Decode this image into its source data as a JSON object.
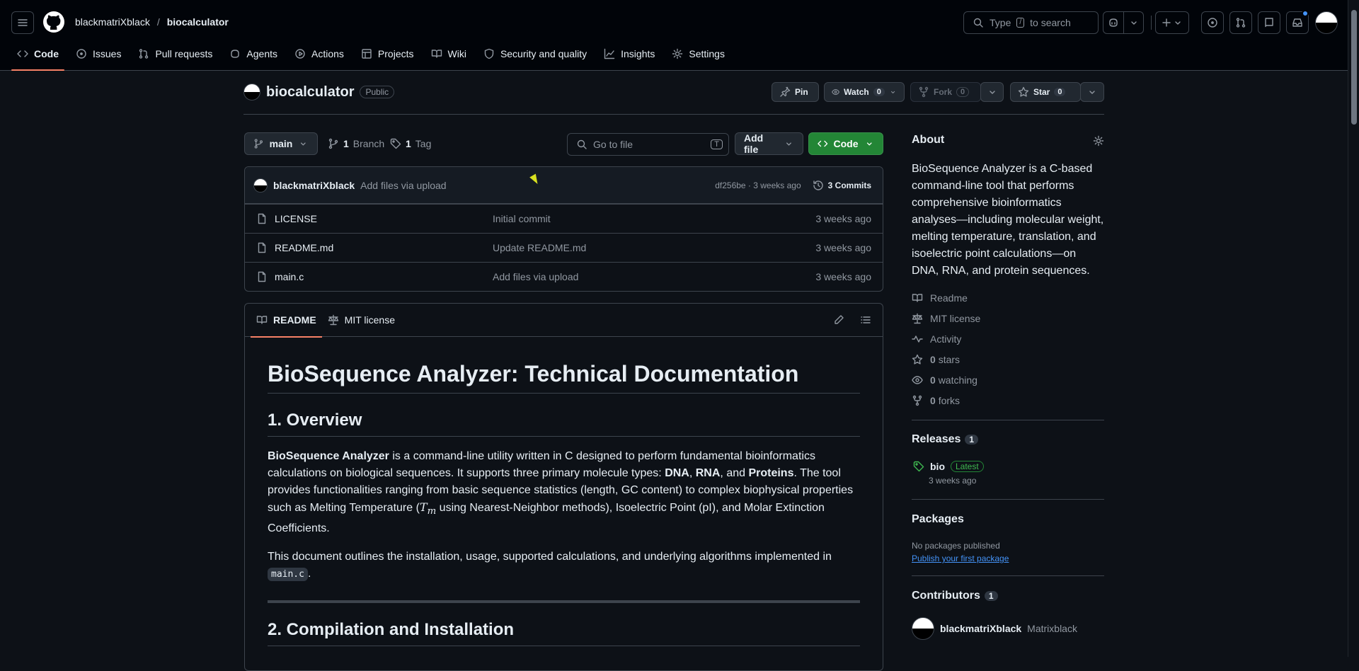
{
  "header": {
    "owner": "blackmatriXblack",
    "separator": "/",
    "repo": "biocalculator",
    "search_pre": "Type",
    "search_key": "/",
    "search_post": "to search"
  },
  "tabs": [
    {
      "label": "Code"
    },
    {
      "label": "Issues"
    },
    {
      "label": "Pull requests"
    },
    {
      "label": "Agents"
    },
    {
      "label": "Actions"
    },
    {
      "label": "Projects"
    },
    {
      "label": "Wiki"
    },
    {
      "label": "Security and quality"
    },
    {
      "label": "Insights"
    },
    {
      "label": "Settings"
    }
  ],
  "repo": {
    "name": "biocalculator",
    "visibility": "Public",
    "pin_label": "Pin",
    "watch_label": "Watch",
    "watch_count": "0",
    "fork_label": "Fork",
    "fork_count": "0",
    "star_label": "Star",
    "star_count": "0"
  },
  "branch_bar": {
    "branch": "main",
    "branch_count": "1",
    "branch_label": "Branch",
    "tag_count": "1",
    "tag_label": "Tag",
    "goto_placeholder": "Go to file",
    "goto_key": "T",
    "add_file": "Add file",
    "code": "Code"
  },
  "latest_commit": {
    "author": "blackmatriXblack",
    "message": "Add files via upload",
    "hash_age": "df256be · 3 weeks ago",
    "commits": "3 Commits"
  },
  "files": [
    {
      "name": "LICENSE",
      "commit": "Initial commit",
      "age": "3 weeks ago"
    },
    {
      "name": "README.md",
      "commit": "Update README.md",
      "age": "3 weeks ago"
    },
    {
      "name": "main.c",
      "commit": "Add files via upload",
      "age": "3 weeks ago"
    }
  ],
  "readme": {
    "tab_readme": "README",
    "tab_license": "MIT license",
    "h1": "BioSequence Analyzer: Technical Documentation",
    "h2_overview": "1. Overview",
    "p1_bold1": "BioSequence Analyzer",
    "p1_t1": " is a command-line utility written in C designed to perform fundamental bioinformatics calculations on biological sequences. It supports three primary molecule types: ",
    "p1_dna": "DNA",
    "p1_t2": ", ",
    "p1_rna": "RNA",
    "p1_t3": ", and ",
    "p1_prot": "Proteins",
    "p1_t4": ". The tool provides functionalities ranging from basic sequence statistics (length, GC content) to complex biophysical properties such as Melting Temperature (",
    "p1_tm": "T",
    "p1_tm_sub": "m",
    "p1_t5": " using Nearest-Neighbor methods), Isoelectric Point (pI), and Molar Extinction Coefficients.",
    "p2_t1": "This document outlines the installation, usage, supported calculations, and underlying algorithms implemented in ",
    "p2_code": "main.c",
    "p2_t2": ".",
    "h2_install": "2. Compilation and Installation"
  },
  "about": {
    "title": "About",
    "description": "BioSequence Analyzer is a C-based command-line tool that performs comprehensive bioinformatics analyses—including molecular weight, melting temperature, translation, and isoelectric point calculations—on DNA, RNA, and protein sequences.",
    "readme": "Readme",
    "license": "MIT license",
    "activity": "Activity",
    "stars_count": "0",
    "stars_label": "stars",
    "watching_count": "0",
    "watching_label": "watching",
    "forks_count": "0",
    "forks_label": "forks"
  },
  "releases": {
    "title": "Releases",
    "count": "1",
    "name": "bio",
    "badge": "Latest",
    "age": "3 weeks ago"
  },
  "packages": {
    "title": "Packages",
    "none": "No packages published",
    "publish": "Publish your first package"
  },
  "contributors": {
    "title": "Contributors",
    "count": "1",
    "login": "blackmatriXblack",
    "name": "Matrixblack"
  },
  "colors": {
    "background": "#0d1117",
    "header": "#010409",
    "border": "#3d444d",
    "accent_tab": "#f78166",
    "code_button": "#238636",
    "link": "#4493f8"
  }
}
